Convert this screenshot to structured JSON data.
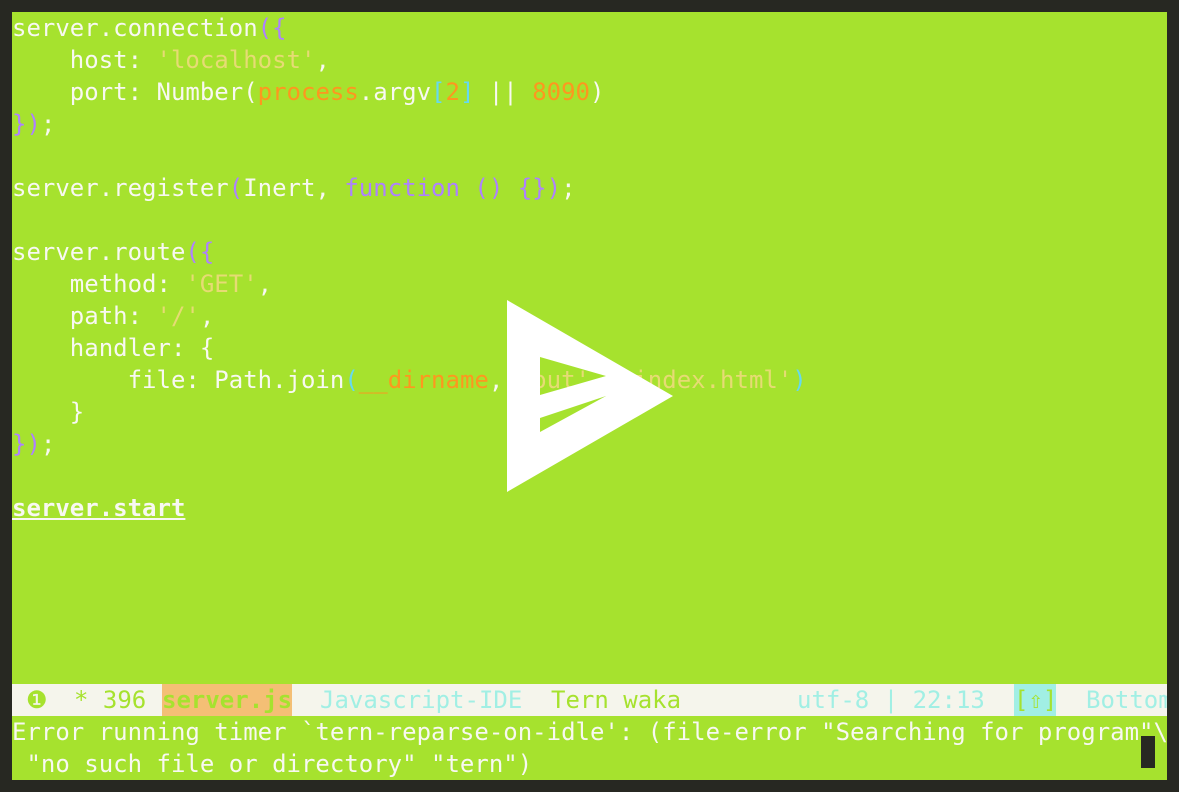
{
  "editor": {
    "lines": [
      {
        "segments": [
          {
            "t": "server.connection"
          },
          {
            "t": "({",
            "c": "p"
          }
        ]
      },
      {
        "segments": [
          {
            "t": "    host: "
          },
          {
            "t": "'localhost'",
            "c": "s"
          },
          {
            "t": ","
          }
        ]
      },
      {
        "segments": [
          {
            "t": "    port: Number("
          },
          {
            "t": "process",
            "c": "n"
          },
          {
            "t": ".argv"
          },
          {
            "t": "[",
            "c": "b"
          },
          {
            "t": "2",
            "c": "n"
          },
          {
            "t": "]",
            "c": "b"
          },
          {
            "t": " || "
          },
          {
            "t": "8090",
            "c": "n"
          },
          {
            "t": ")"
          }
        ]
      },
      {
        "segments": [
          {
            "t": "})",
            "c": "p"
          },
          {
            "t": ";"
          }
        ]
      },
      {
        "segments": []
      },
      {
        "segments": [
          {
            "t": "server.register"
          },
          {
            "t": "(",
            "c": "p"
          },
          {
            "t": "Inert, "
          },
          {
            "t": "function",
            "c": "p"
          },
          {
            "t": " () {}",
            "c": "p"
          },
          {
            "t": ")",
            "c": "p"
          },
          {
            "t": ";"
          }
        ]
      },
      {
        "segments": []
      },
      {
        "segments": [
          {
            "t": "server.route"
          },
          {
            "t": "({",
            "c": "p"
          }
        ]
      },
      {
        "segments": [
          {
            "t": "    method: "
          },
          {
            "t": "'GET'",
            "c": "s"
          },
          {
            "t": ","
          }
        ]
      },
      {
        "segments": [
          {
            "t": "    path: "
          },
          {
            "t": "'/'",
            "c": "s"
          },
          {
            "t": ","
          }
        ]
      },
      {
        "segments": [
          {
            "t": "    handler: {"
          }
        ]
      },
      {
        "segments": [
          {
            "t": "        file: Path.join"
          },
          {
            "t": "(",
            "c": "b"
          },
          {
            "t": "__dirname",
            "c": "n"
          },
          {
            "t": ", "
          },
          {
            "t": "'out', 'index.html'",
            "c": "s"
          },
          {
            "t": ")",
            "c": "b"
          }
        ]
      },
      {
        "segments": [
          {
            "t": "    }"
          }
        ]
      },
      {
        "segments": [
          {
            "t": "})",
            "c": "p"
          },
          {
            "t": ";"
          }
        ]
      },
      {
        "segments": []
      },
      {
        "segments": [
          {
            "t": "server.start",
            "c": "u"
          }
        ]
      }
    ]
  },
  "modeline": {
    "window_number": "❶",
    "modified_and_size": "* 396",
    "filename": "server.js",
    "major_mode": "Javascript-IDE",
    "minor_modes": "Tern waka",
    "encoding_and_position": "utf-8 | 22:13",
    "indicator": "[⇧]",
    "scroll_position": "Bottom"
  },
  "echo_area": {
    "line1": "Error running timer `tern-reparse-on-idle': (file-error \"Searching for program\"\\",
    "line2": " \"no such file or directory\" \"tern\")"
  },
  "colors": {
    "frame": "#272822",
    "background": "#a6e22e",
    "foreground": "#f8f8f2",
    "purple": "#ae81ff",
    "yellow": "#e6db74",
    "orange": "#fd971f",
    "cyan": "#66d9ef",
    "modeline_bg": "#f5f5ec",
    "filename_bg": "#f4bf75"
  },
  "overlay": {
    "icon": "play-logo-icon"
  }
}
